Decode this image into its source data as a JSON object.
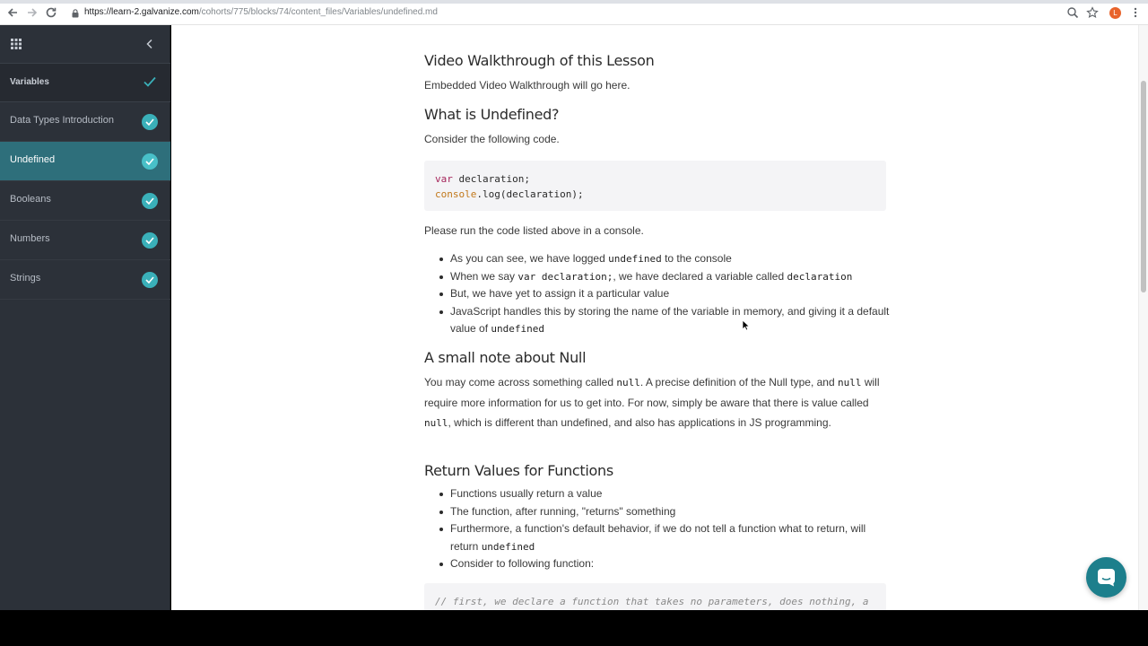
{
  "browser": {
    "url_host": "https://learn-2.galvanize.com",
    "url_path": "/cohorts/775/blocks/74/content_files/Variables/undefined.md",
    "profile_initial": "L"
  },
  "sidebar": {
    "section_title": "Variables",
    "items": [
      {
        "label": "Data Types Introduction",
        "completed": true
      },
      {
        "label": "Undefined",
        "completed": true,
        "active": true
      },
      {
        "label": "Booleans",
        "completed": true
      },
      {
        "label": "Numbers",
        "completed": true
      },
      {
        "label": "Strings",
        "completed": true
      }
    ]
  },
  "lesson": {
    "video_heading": "Video Walkthrough of this Lesson",
    "video_text": "Embedded Video Walkthrough will go here.",
    "undefined_heading": "What is Undefined?",
    "undefined_intro": "Consider the following code.",
    "code1": {
      "line1_kw": "var",
      "line1_rest": " declaration;",
      "line2_obj": "console",
      "line2_rest": ".log(declaration);"
    },
    "run_text": "Please run the code listed above in a console.",
    "bullets1": {
      "b1_a": "As you can see, we have logged ",
      "b1_code": "undefined",
      "b1_b": " to the console",
      "b2_a": "When we say ",
      "b2_code": "var declaration;",
      "b2_b": ", we have declared a variable called ",
      "b2_code2": "declaration",
      "b3": "But, we have yet to assign it a particular value",
      "b4_a": "JavaScript handles this by storing the name of the variable in memory, and giving it a default value of ",
      "b4_code": "undefined"
    },
    "null_heading": "A small note about Null",
    "null_p": {
      "a": "You may come across something called ",
      "c1": "null",
      "b": ". A precise definition of the Null type, and ",
      "c2": "null",
      "d": " will require more information for us to get into. For now, simply be aware that there is value called ",
      "c3": "null",
      "e": ", which is different than undefined, and also has applications in JS programming."
    },
    "return_heading": "Return Values for Functions",
    "bullets2": {
      "b1": "Functions usually return a value",
      "b2": "The function, after running, \"returns\" something",
      "b3_a": "Furthermore, a function's default behavior, if we do not tell a function what to return, will return ",
      "b3_code": "undefined",
      "b4": "Consider to following function:"
    },
    "code2_comment": "// first, we declare a function that takes no parameters, does nothing, a"
  },
  "colors": {
    "sidebar_bg": "#2c3139",
    "active_item_bg": "#2e6f7b",
    "check_badge": "#3ab0b9",
    "chat_button": "#1d7f8c"
  }
}
